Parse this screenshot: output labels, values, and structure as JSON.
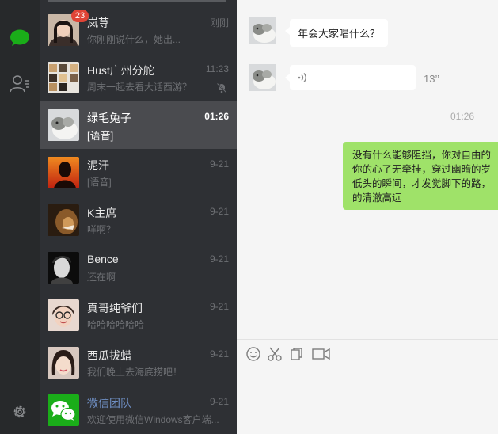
{
  "rail": {
    "items": [
      {
        "icon": "chat-bubble-icon",
        "active": true,
        "color": "#1aad19"
      },
      {
        "icon": "contacts-icon",
        "active": false
      }
    ],
    "settings_icon": "gear-icon"
  },
  "conversations": [
    {
      "name": "岚荨",
      "preview": "你刚刚说什么，她出...",
      "time": "刚刚",
      "badge": "23",
      "avatar": "girl-photo"
    },
    {
      "name": "Hust广州分舵",
      "preview": "周末一起去看大话西游？",
      "time": "11:23",
      "muted": true,
      "avatar": "group-grid"
    },
    {
      "name": "绿毛兔子",
      "preview": "[语音]",
      "time": "01:26",
      "active": true,
      "avatar": "rabbit-photo"
    },
    {
      "name": "泥汗",
      "preview": "[语音]",
      "time": "9-21",
      "avatar": "sunset-silhouette"
    },
    {
      "name": "K主席",
      "preview": "咩啊？",
      "time": "9-21",
      "avatar": "lion-photo"
    },
    {
      "name": "Bence",
      "preview": "还在啊",
      "time": "9-21",
      "avatar": "bw-portrait"
    },
    {
      "name": "真哥纯爷们",
      "preview": "哈哈哈哈哈哈",
      "time": "9-21",
      "avatar": "glasses-girl"
    },
    {
      "name": "西瓜拔蜡",
      "preview": "我们晚上去海底捞吧！",
      "time": "9-21",
      "avatar": "girl-selfie"
    },
    {
      "name": "微信团队",
      "preview": "欢迎使用微信Windows客户端...",
      "time": "9-21",
      "avatar": "wechat-logo"
    }
  ],
  "chat": {
    "messages": [
      {
        "type": "text-in",
        "text": "年会大家唱什么？"
      },
      {
        "type": "voice-in",
        "duration": "13’’"
      },
      {
        "type": "timestamp",
        "text": "01:26"
      },
      {
        "type": "text-out",
        "lines": [
          "没有什么能够阻挡，你对自由的",
          "你的心了无牵挂，穿过幽暗的岁",
          "低头的瞬间，才发觉脚下的路，",
          "的清澈高远"
        ]
      }
    ],
    "toolbar": [
      "emoji-icon",
      "scissors-icon",
      "copy-icon",
      "video-call-icon"
    ]
  },
  "colors": {
    "rail_bg": "#27292b",
    "list_bg": "#2e3034",
    "active_bg": "#4a4b4f",
    "out_bubble": "#9fe269",
    "badge": "#e04436",
    "brand_green": "#1aad19"
  }
}
